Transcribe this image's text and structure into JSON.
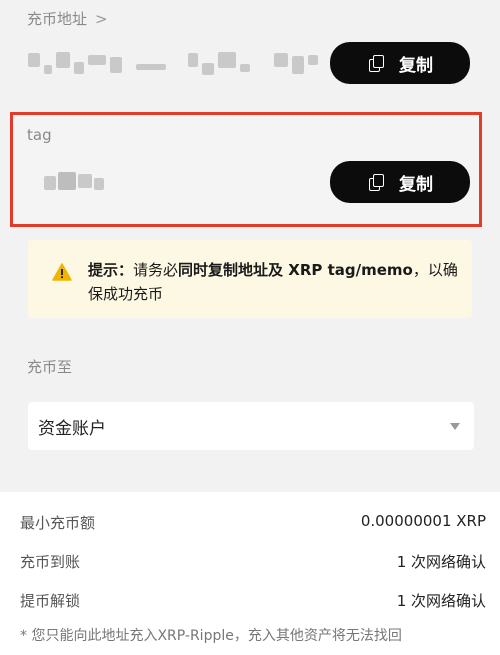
{
  "address_section": {
    "label": "充币地址",
    "chevron": ">",
    "copy_label": "复制"
  },
  "tag_section": {
    "label": "tag",
    "copy_label": "复制"
  },
  "hint": {
    "prefix": "提示：",
    "text_part1": "请务必",
    "bold_text": "同时复制地址及 XRP tag/memo",
    "text_part2": "，以确保成功充币",
    "icon": "warning-icon",
    "bg_color": "#fdf8e3"
  },
  "deposit_to": {
    "label": "充币至",
    "selected": "资金账户"
  },
  "info": {
    "rows": [
      {
        "key": "最小充币额",
        "value": "0.00000001 XRP"
      },
      {
        "key": "充币到账",
        "value": "1 次网络确认"
      },
      {
        "key": "提币解锁",
        "value": "1 次网络确认"
      }
    ],
    "footnote": "* 您只能向此地址充入XRP-Ripple，充入其他资产将无法找回"
  },
  "colors": {
    "accent_border": "#e23b2a",
    "button_bg": "#0c0c0c"
  }
}
